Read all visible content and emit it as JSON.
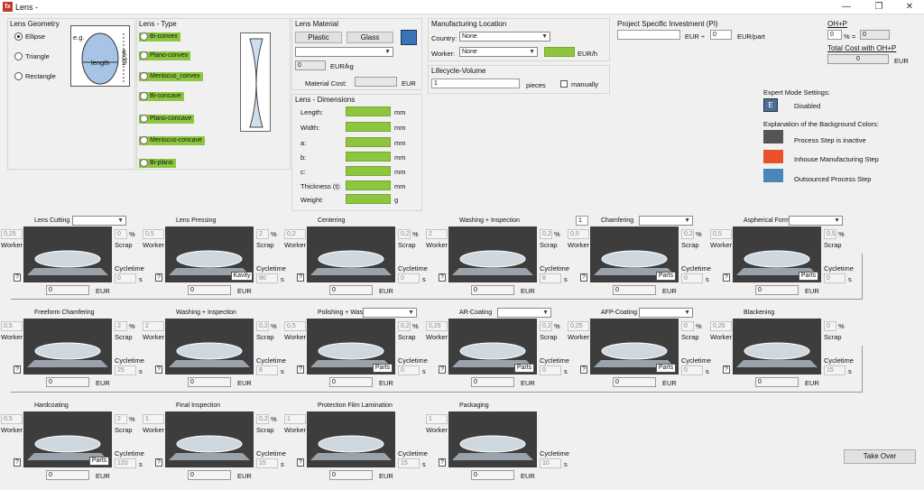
{
  "window": {
    "title": "Lens -",
    "icon": "app-icon",
    "controls": [
      "minimize-icon",
      "maximize-icon",
      "close-icon"
    ]
  },
  "geometry": {
    "label": "Lens Geometry",
    "options": [
      "Ellipse",
      "Triangle",
      "Rectangle"
    ],
    "selected": "Ellipse",
    "eg": "e.g.",
    "length": "length",
    "width": "width"
  },
  "type": {
    "label": "Lens - Type",
    "items": [
      "Bi-convex",
      "Plano-convex",
      "Meniscus_convex",
      "Bi-concave",
      "Plano-concave",
      "Meniscus-concave",
      "Bi-plano"
    ]
  },
  "material": {
    "label": "Lens Material",
    "plastic": "Plastic",
    "glass": "Glass",
    "price": "0",
    "price_unit": "EUR/kg",
    "cost_label": "Material Cost:",
    "cost_unit": "EUR",
    "db_icon": "database-icon"
  },
  "dims": {
    "label": "Lens - Dimensions",
    "rows": [
      {
        "l": "Length:",
        "u": "mm"
      },
      {
        "l": "Width:",
        "u": "mm"
      },
      {
        "l": "a:",
        "u": "mm"
      },
      {
        "l": "b:",
        "u": "mm"
      },
      {
        "l": "c:",
        "u": "mm"
      },
      {
        "l": "Thickness (t):",
        "u": "mm"
      },
      {
        "l": "Weight:",
        "u": "g"
      }
    ]
  },
  "mfg": {
    "label": "Manufacturing Location",
    "country_label": "Country:",
    "country": "None",
    "worker_label": "Worker:",
    "worker": "None",
    "rate_unit": "EUR/h"
  },
  "volume": {
    "label": "Lifecycle-Volume",
    "value": "1",
    "unit": "pieces",
    "manual": "manually"
  },
  "pi": {
    "label": "Project Specific Investment (PI)",
    "unit": "EUR",
    "sep": "÷",
    "count": "0",
    "per": "EUR/part"
  },
  "ohp": {
    "label": "OH+P",
    "value": "0",
    "pct": "%",
    "eq": "=",
    "result": "0",
    "total_label": "Total Cost with OH+P",
    "total": "0",
    "total_unit": "EUR"
  },
  "expert": {
    "label": "Expert Mode Settings:",
    "button": "E",
    "state": "Disabled",
    "legend_title": "Explanation of the Background Colors:",
    "legend": [
      {
        "color": "#555555",
        "text": "Process Step is inactive"
      },
      {
        "color": "#e8512a",
        "text": "Inhouse Manufacturing Step"
      },
      {
        "color": "#4a86b8",
        "text": "Outsourced Process Step"
      }
    ]
  },
  "labels": {
    "worker": "Worker",
    "scrap": "Scrap",
    "cycletime": "Cycletime",
    "eur": "EUR",
    "pct": "%",
    "s": "s",
    "q": "?",
    "parts": "Parts",
    "kavity": "Kavity"
  },
  "steps": [
    {
      "title": "Lens Cutting",
      "worker": "0,25",
      "scrap": "0",
      "cycle": "0",
      "cost": "0",
      "dropdown": true
    },
    {
      "title": "Lens Pressing",
      "worker": "0,5",
      "scrap": "2",
      "cycle": "80",
      "cost": "0",
      "kavity": true
    },
    {
      "title": "Centering",
      "worker": "0,2",
      "scrap": "0,2",
      "cycle": "0",
      "cost": "0"
    },
    {
      "title": "Washing + Inspection",
      "worker": "2",
      "scrap": "0,2",
      "cycle": "8",
      "cost": "0"
    },
    {
      "title": "Chamfering",
      "worker": "0,5",
      "scrap": "0,2",
      "cycle": "0",
      "cost": "0",
      "dropdown": true,
      "parts": true,
      "pre": "1"
    },
    {
      "title": "Aspherical Forming",
      "worker": "0,5",
      "scrap": "0,5",
      "cycle": "0",
      "cost": "0",
      "dropdown": true,
      "parts": true
    },
    {
      "title": "Freeform Chamfering",
      "worker": "0,5",
      "scrap": "2",
      "cycle": "25",
      "cost": "0"
    },
    {
      "title": "Washing + Inspection",
      "worker": "2",
      "scrap": "0,2",
      "cycle": "8",
      "cost": "0"
    },
    {
      "title": "Polishing + Washing",
      "worker": "0,5",
      "scrap": "0,2",
      "cycle": "0",
      "cost": "0",
      "dropdown": true,
      "parts": true
    },
    {
      "title": "AR-Coating",
      "worker": "0,25",
      "scrap": "0,2",
      "cycle": "0",
      "cost": "0",
      "dropdown": true,
      "parts": true
    },
    {
      "title": "AFP-Coating",
      "worker": "0,25",
      "scrap": "0",
      "cycle": "0",
      "cost": "0",
      "dropdown": true,
      "parts": true
    },
    {
      "title": "Blackening",
      "worker": "0,25",
      "scrap": "0",
      "cycle": "15",
      "cost": "0"
    },
    {
      "title": "Hardcoating",
      "worker": "0,5",
      "scrap": "2",
      "cycle": "120",
      "cost": "0",
      "parts": true
    },
    {
      "title": "Final Inspection",
      "worker": "1",
      "scrap": "0,2",
      "cycle": "15",
      "cost": "0"
    },
    {
      "title": "Protection Film Lamination",
      "worker": "1",
      "scrap": "",
      "cycle": "15",
      "cost": "0"
    },
    {
      "title": "Packaging",
      "worker": "1",
      "scrap": "",
      "cycle": "10",
      "cost": "0"
    }
  ],
  "take_over": "Take Over"
}
